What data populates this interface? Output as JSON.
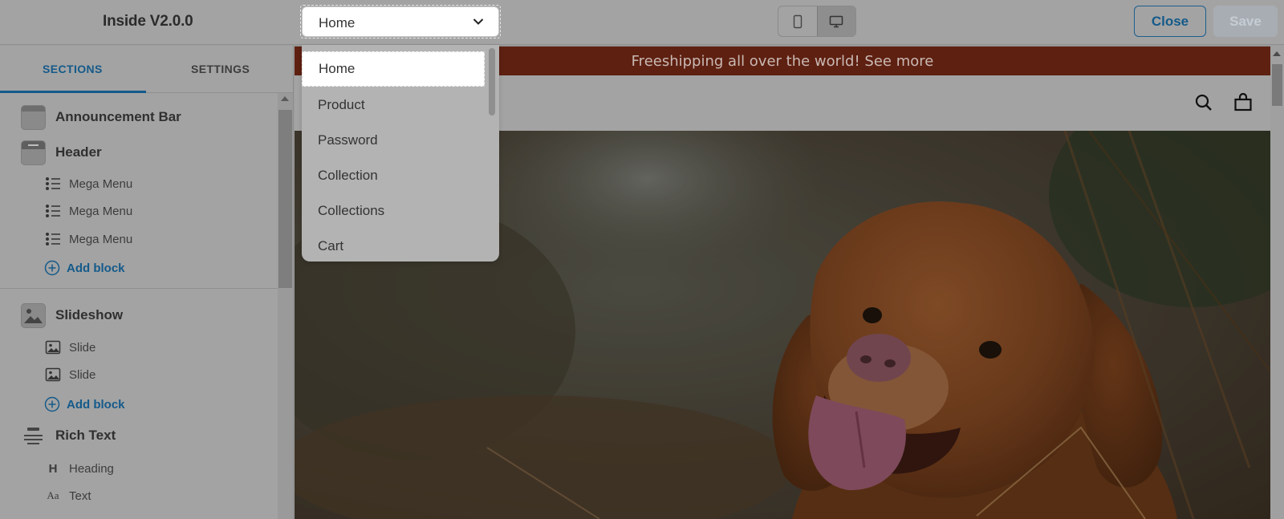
{
  "app": {
    "title": "Inside V2.0.0"
  },
  "page_select": {
    "value": "Home",
    "options": [
      "Home",
      "Product",
      "Password",
      "Collection",
      "Collections",
      "Cart"
    ]
  },
  "toolbar": {
    "close_label": "Close",
    "save_label": "Save"
  },
  "sidebar": {
    "tabs": [
      {
        "label": "SECTIONS"
      },
      {
        "label": "SETTINGS"
      }
    ],
    "sections": [
      {
        "label": "Announcement Bar",
        "icon": "announcement-bar-icon"
      },
      {
        "label": "Header",
        "icon": "header-icon",
        "blocks": [
          {
            "label": "Mega Menu"
          },
          {
            "label": "Mega Menu"
          },
          {
            "label": "Mega Menu"
          }
        ],
        "add_label": "Add block"
      },
      {
        "label": "Slideshow",
        "icon": "slideshow-icon",
        "blocks": [
          {
            "label": "Slide"
          },
          {
            "label": "Slide"
          }
        ],
        "add_label": "Add block"
      },
      {
        "label": "Rich Text",
        "icon": "rich-text-icon",
        "blocks": [
          {
            "label": "Heading",
            "icon_text": "H"
          },
          {
            "label": "Text",
            "icon_text": "Aa"
          }
        ]
      }
    ]
  },
  "preview": {
    "announcement": "Freeshipping all over the world! See more"
  },
  "colors": {
    "accent": "#145a8a",
    "announcement_bg": "#5e2011"
  }
}
